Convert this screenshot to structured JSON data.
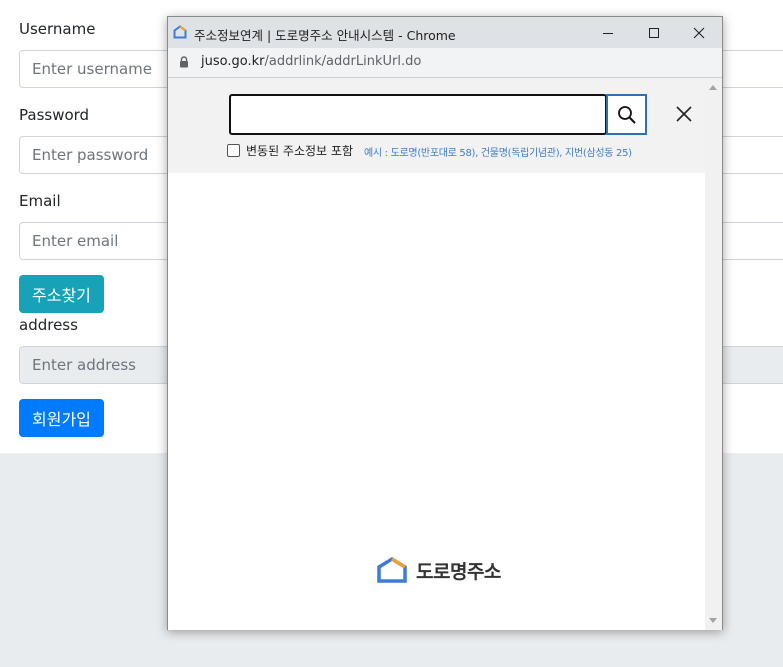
{
  "form": {
    "username_label": "Username",
    "username_placeholder": "Enter username",
    "password_label": "Password",
    "password_placeholder": "Enter password",
    "email_label": "Email",
    "email_placeholder": "Enter email",
    "find_address_button": "주소찾기",
    "address_label": "address",
    "address_placeholder": "Enter address",
    "signup_button": "회원가입"
  },
  "popup": {
    "window_title": "주소정보연계 | 도로명주소 안내시스템 - Chrome",
    "url_domain": "juso.go.kr",
    "url_path": "/addrlink/addrLinkUrl.do",
    "search_value": "",
    "include_changed_label": "변동된 주소정보 포함",
    "example_text": "예시 : 도로명(반포대로 58), 건물명(독립기념관), 지번(삼성동 25)",
    "logo_text": "도로명주소"
  },
  "colors": {
    "find_address_button": "#17a2b8",
    "signup_button": "#007bff",
    "search_button_border": "#2f6fb8",
    "example_text": "#3e7cc6",
    "logo_blue": "#3d7bd6",
    "logo_orange": "#f0a030"
  }
}
